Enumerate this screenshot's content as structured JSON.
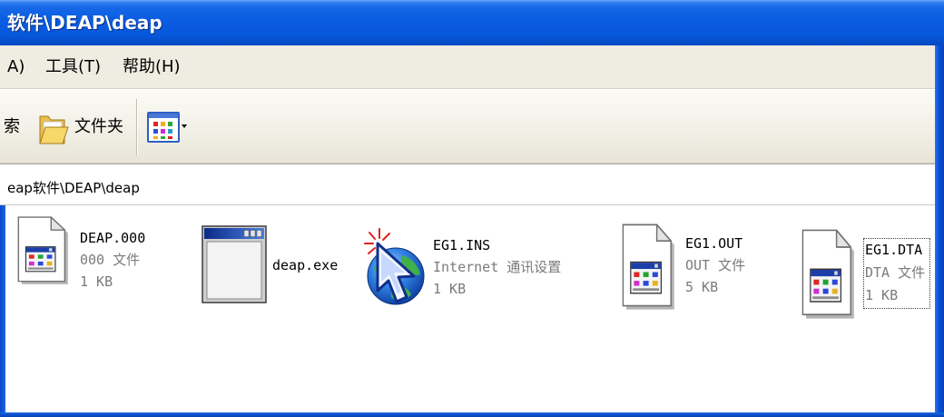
{
  "window": {
    "title": "软件\\DEAP\\deap"
  },
  "menu": {
    "items": [
      {
        "label": "A)"
      },
      {
        "label": "工具(T)"
      },
      {
        "label": "帮助(H)"
      }
    ]
  },
  "toolbar": {
    "search_label": "索",
    "folders_label": "文件夹",
    "folders_icon": "folder-icon",
    "views_icon": "views-icon"
  },
  "address": {
    "value": "eap软件\\DEAP\\deap"
  },
  "files": [
    {
      "name": "DEAP.000",
      "type": "000 文件",
      "size": "1 KB",
      "icon": "document-icon"
    },
    {
      "name": "deap.exe",
      "icon": "application-window-icon"
    },
    {
      "name": "EG1.INS",
      "type": "Internet 通讯设置",
      "size": "1 KB",
      "icon": "internet-settings-icon"
    },
    {
      "name": "EG1.OUT",
      "type": "OUT 文件",
      "size": "5 KB",
      "icon": "document-icon"
    },
    {
      "name": "EG1.DTA",
      "type": "DTA 文件",
      "size": "1 KB",
      "icon": "document-icon",
      "focused": true
    }
  ],
  "colors": {
    "title_bar": "#0B5DE1",
    "menu_bar": "#EFEDE2",
    "window_frame": "#0A52DA",
    "secondary_text": "#7B7B7B",
    "background": "#FFFFFF"
  }
}
